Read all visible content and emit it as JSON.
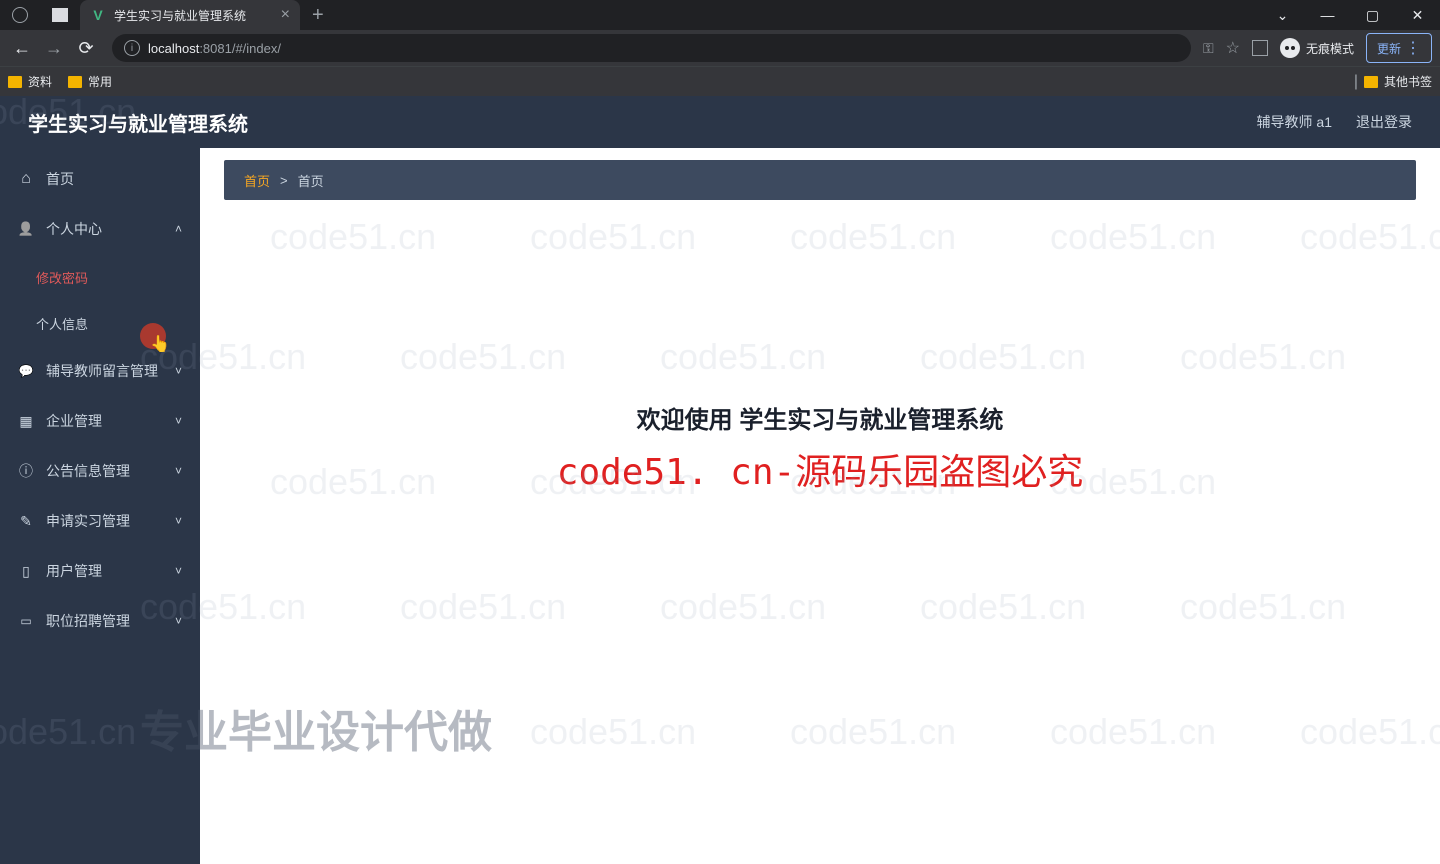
{
  "browser": {
    "tab_title": "学生实习与就业管理系统",
    "url_host": "localhost",
    "url_port_path": ":8081/#/index/",
    "incognito_label": "无痕模式",
    "update_label": "更新",
    "bookmarks": [
      "资料",
      "常用"
    ],
    "other_bookmarks": "其他书签"
  },
  "header": {
    "title": "学生实习与就业管理系统",
    "user_label": "辅导教师 a1",
    "logout": "退出登录"
  },
  "breadcrumb": {
    "home": "首页",
    "sep": ">",
    "current": "首页"
  },
  "sidebar": {
    "home": "首页",
    "personal_center": "个人中心",
    "change_password": "修改密码",
    "personal_info": "个人信息",
    "teacher_msg": "辅导教师留言管理",
    "enterprise": "企业管理",
    "notice": "公告信息管理",
    "apply_intern": "申请实习管理",
    "user_mgmt": "用户管理",
    "job_recruit": "职位招聘管理"
  },
  "main": {
    "welcome": "欢迎使用 学生实习与就业管理系统",
    "red_overlay": "code51. cn-源码乐园盗图必究"
  },
  "watermark": {
    "text": "code51.cn",
    "big": "专业毕业设计代做"
  }
}
